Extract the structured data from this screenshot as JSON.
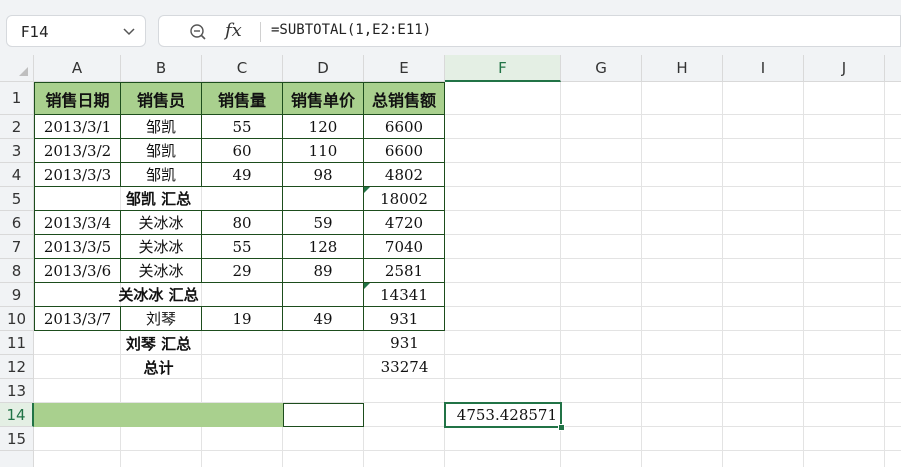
{
  "formula_bar": {
    "name_box": "F14",
    "fx_label": "fx",
    "formula": "=SUBTOTAL(1,E2:E11)"
  },
  "columns": [
    "A",
    "B",
    "C",
    "D",
    "E",
    "F",
    "G",
    "H",
    "I",
    "J"
  ],
  "rows": [
    "1",
    "2",
    "3",
    "4",
    "5",
    "6",
    "7",
    "8",
    "9",
    "10",
    "11",
    "12",
    "13",
    "14",
    "15"
  ],
  "active_cell": "F14",
  "table": {
    "headers": [
      "销售日期",
      "销售员",
      "销售量",
      "销售单价",
      "总销售额"
    ],
    "records": [
      {
        "date": "2013/3/1",
        "rep": "邹凯",
        "qty": "55",
        "price": "120",
        "total": "6600"
      },
      {
        "date": "2013/3/2",
        "rep": "邹凯",
        "qty": "60",
        "price": "110",
        "total": "6600"
      },
      {
        "date": "2013/3/3",
        "rep": "邹凯",
        "qty": "49",
        "price": "98",
        "total": "4802"
      },
      {
        "subtotal_label": "邹凯 汇总",
        "total": "18002"
      },
      {
        "date": "2013/3/4",
        "rep": "关冰冰",
        "qty": "80",
        "price": "59",
        "total": "4720"
      },
      {
        "date": "2013/3/5",
        "rep": "关冰冰",
        "qty": "55",
        "price": "128",
        "total": "7040"
      },
      {
        "date": "2013/3/6",
        "rep": "关冰冰",
        "qty": "29",
        "price": "89",
        "total": "2581"
      },
      {
        "subtotal_label": "关冰冰 汇总",
        "total": "14341"
      },
      {
        "date": "2013/3/7",
        "rep": "刘琴",
        "qty": "19",
        "price": "49",
        "total": "931"
      },
      {
        "subtotal_label": "刘琴 汇总",
        "total": "931"
      },
      {
        "subtotal_label": "总计",
        "total": "33274"
      }
    ]
  },
  "f14_value": "4753.428571",
  "colors": {
    "header_fill": "#a9d08e",
    "accent": "#217346"
  }
}
